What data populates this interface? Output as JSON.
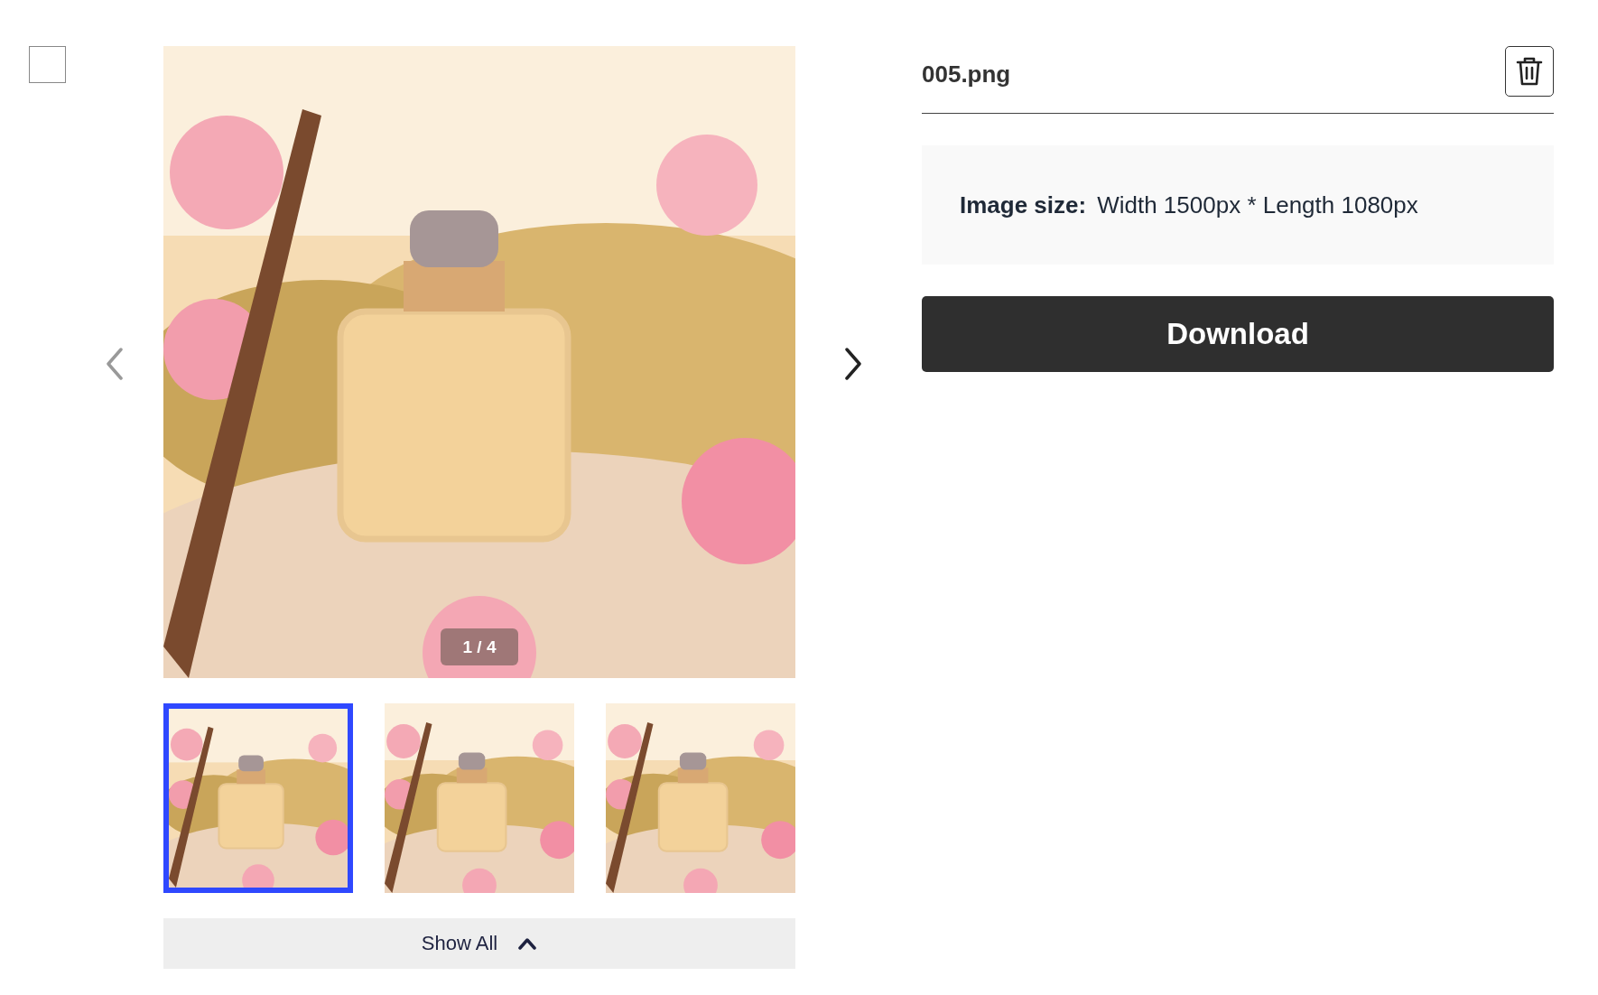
{
  "select_checkbox": {
    "checked": false
  },
  "gallery": {
    "prev": {
      "disabled": true
    },
    "next": {
      "disabled": false
    },
    "counter": "1 / 4",
    "thumbnails": [
      {
        "selected": true
      },
      {
        "selected": false
      },
      {
        "selected": false
      }
    ],
    "show_all": {
      "label": "Show All",
      "expanded": true
    }
  },
  "details": {
    "filename": "005.png",
    "info": {
      "label": "Image size:",
      "value": "Width 1500px * Length 1080px"
    },
    "download": "Download"
  }
}
